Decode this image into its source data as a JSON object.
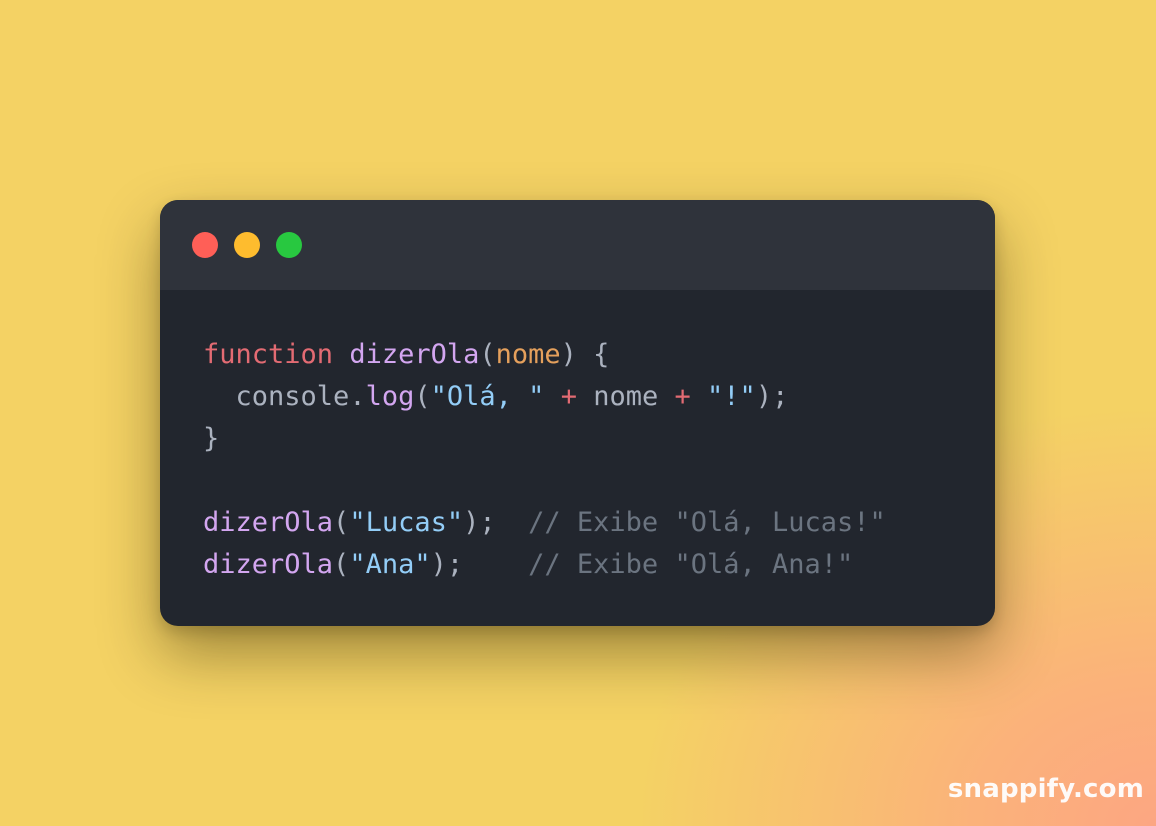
{
  "window": {
    "controls": [
      {
        "name": "close",
        "color": "#ff5f57"
      },
      {
        "name": "minimize",
        "color": "#febc2e"
      },
      {
        "name": "maximize",
        "color": "#28c840"
      }
    ]
  },
  "code": {
    "line1": {
      "keyword": "function",
      "space1": " ",
      "fn_name": "dizerOla",
      "paren_open": "(",
      "param": "nome",
      "paren_close_brace": ") {"
    },
    "line2": {
      "indent": "  ",
      "object": "console",
      "dot": ".",
      "method": "log",
      "paren_open": "(",
      "str1": "\"Olá, \"",
      "space_a": " ",
      "plus1": "+",
      "mid": " nome ",
      "plus2": "+",
      "space_b": " ",
      "str2": "\"!\"",
      "end": ");"
    },
    "line3": {
      "brace": "}"
    },
    "line5": {
      "fn_name": "dizerOla",
      "paren_open": "(",
      "str": "\"Lucas\"",
      "end": ");",
      "gap": "  ",
      "comment": "// Exibe \"Olá, Lucas!\""
    },
    "line6": {
      "fn_name": "dizerOla",
      "paren_open": "(",
      "str": "\"Ana\"",
      "end": ");",
      "gap": "    ",
      "comment": "// Exibe \"Olá, Ana!\""
    }
  },
  "colors": {
    "background": "#f4d264",
    "window": "#22262e",
    "titlebar": "#2f333b",
    "keyword": "#e36b73",
    "function": "#d3a6f0",
    "parameter": "#e5a05c",
    "string": "#93cdf7",
    "comment": "#6b7480"
  },
  "watermark": "snappify.com"
}
